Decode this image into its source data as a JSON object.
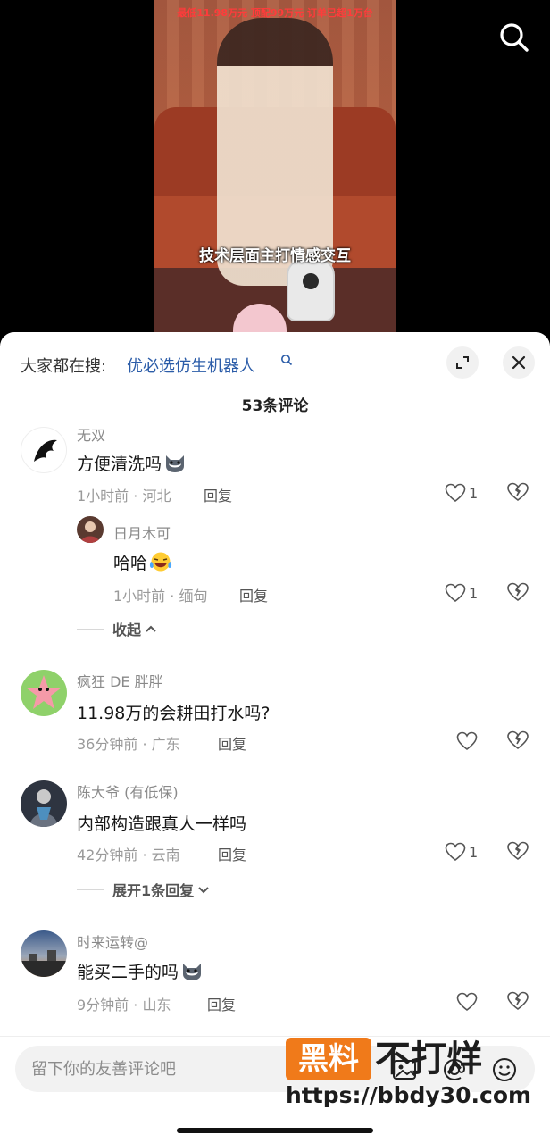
{
  "video": {
    "banner_text": "最低11.98万元 顶配99万元 订单已超1万台",
    "subtitle": "技术层面主打情感交互",
    "search_icon": "search-icon"
  },
  "sheet": {
    "trending_label": "大家都在搜:",
    "trending_query": "优必选仿生机器人",
    "comment_count_label": "53条评论"
  },
  "comments": [
    {
      "username": "无双",
      "text": "方便清洗吗",
      "emoji": "husky-emoji",
      "meta": "1小时前 · 河北",
      "reply_label": "回复",
      "likes": "1",
      "replies": [
        {
          "username": "日月木可",
          "text": "哈哈",
          "emoji": "laughing-crying-emoji",
          "meta": "1小时前 · 缅甸",
          "reply_label": "回复",
          "likes": "1"
        }
      ],
      "thread_toggle": "收起"
    },
    {
      "username": "疯狂 DE 胖胖",
      "text": "11.98万的会耕田打水吗?",
      "meta": "36分钟前 · 广东",
      "reply_label": "回复",
      "likes": ""
    },
    {
      "username": "陈大爷 (有低保)",
      "text": "内部构造跟真人一样吗",
      "meta": "42分钟前 · 云南",
      "reply_label": "回复",
      "likes": "1",
      "thread_toggle": "展开1条回复"
    },
    {
      "username": "时来运转@",
      "text": "能买二手的吗",
      "emoji": "husky-emoji",
      "meta": "9分钟前 · 山东",
      "reply_label": "回复",
      "likes": ""
    }
  ],
  "input_bar": {
    "placeholder": "留下你的友善评论吧",
    "icons": [
      "image-icon",
      "at-icon",
      "emoji-icon"
    ]
  },
  "watermark": {
    "badge": "黑料",
    "title": "不打烊",
    "url": "https://bbdy30.com"
  },
  "colors": {
    "link_blue": "#2b5ca8",
    "watermark_orange": "#f07a1a",
    "banner_red": "#ff3b3b"
  }
}
